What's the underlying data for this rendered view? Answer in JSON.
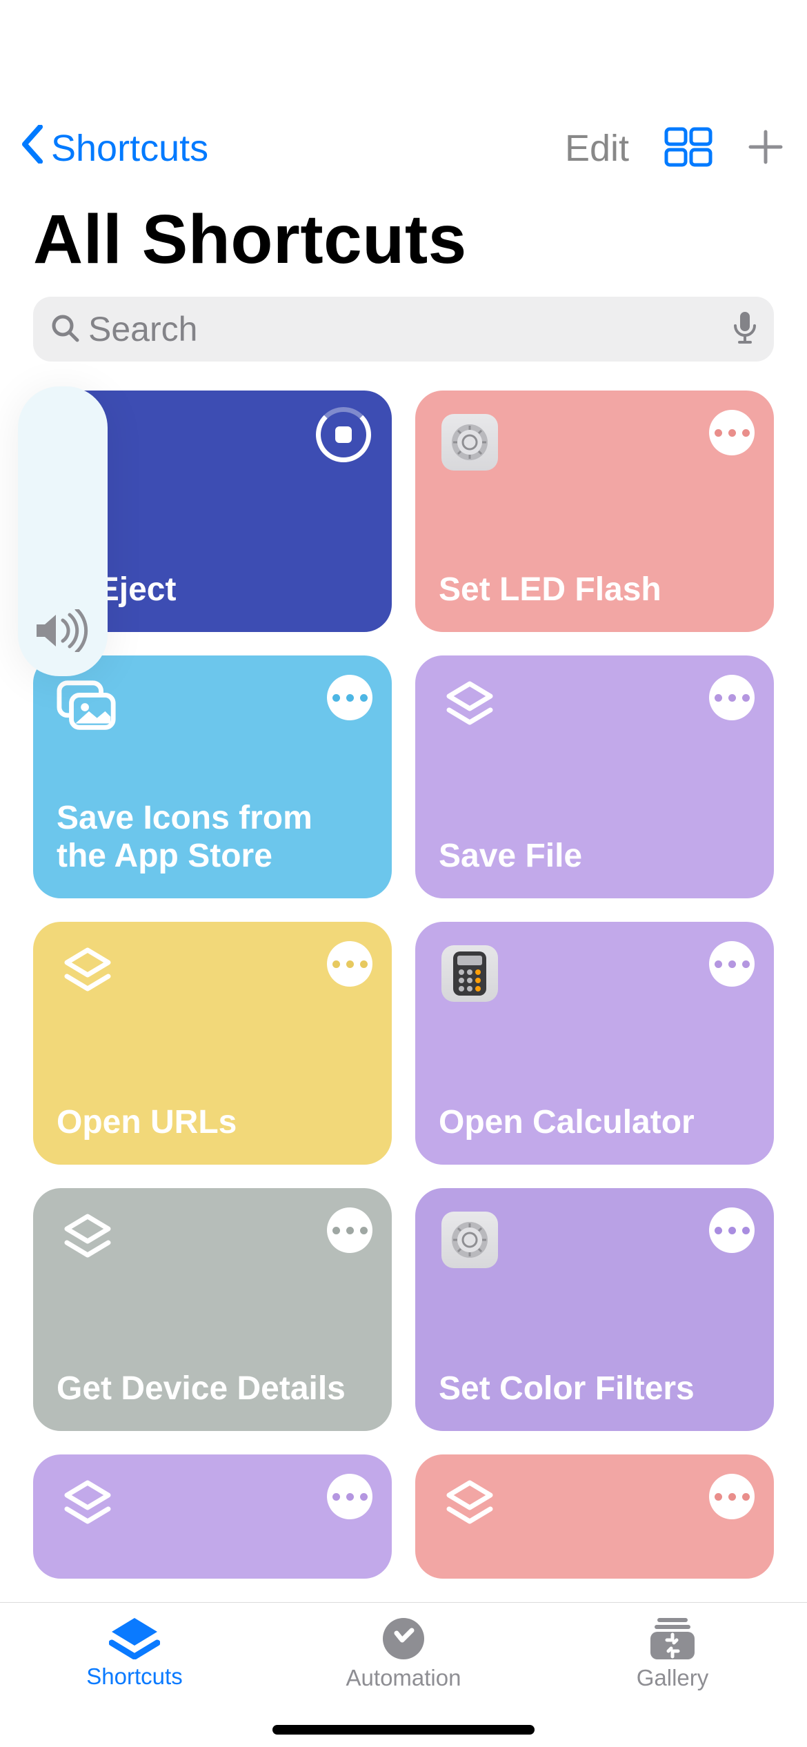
{
  "nav": {
    "back_label": "Shortcuts",
    "edit_label": "Edit"
  },
  "title": "All Shortcuts",
  "search": {
    "placeholder": "Search"
  },
  "shortcuts": [
    {
      "title": "Water Eject",
      "visible_title": "er Eject",
      "color": "col-blue",
      "icon": "running",
      "running": true
    },
    {
      "title": "Set LED Flash",
      "color": "col-salmon",
      "icon": "settings-app",
      "dot_color": "#e98e8b"
    },
    {
      "title": "Save Icons from the App Store",
      "color": "col-skyblue",
      "icon": "photos",
      "dot_color": "#4db6e4"
    },
    {
      "title": "Save File",
      "color": "col-lavender",
      "icon": "layers",
      "dot_color": "#b496e0"
    },
    {
      "title": "Open URLs",
      "color": "col-yellow",
      "icon": "layers",
      "dot_color": "#e7c95f"
    },
    {
      "title": "Open Calculator",
      "color": "col-lavender",
      "icon": "calculator-app",
      "dot_color": "#b496e0"
    },
    {
      "title": "Get Device Details",
      "color": "col-grey",
      "icon": "layers",
      "dot_color": "#9fa7a3"
    },
    {
      "title": "Set Color Filters",
      "color": "col-lavender2",
      "icon": "settings-app",
      "dot_color": "#a98de0"
    },
    {
      "title": "",
      "color": "col-lavender",
      "icon": "layers",
      "dot_color": "#b496e0",
      "partial": true
    },
    {
      "title": "",
      "color": "col-pink",
      "icon": "layers",
      "dot_color": "#e98e8b",
      "partial": true
    }
  ],
  "tabs": [
    {
      "label": "Shortcuts",
      "active": true
    },
    {
      "label": "Automation",
      "active": false
    },
    {
      "label": "Gallery",
      "active": false
    }
  ]
}
